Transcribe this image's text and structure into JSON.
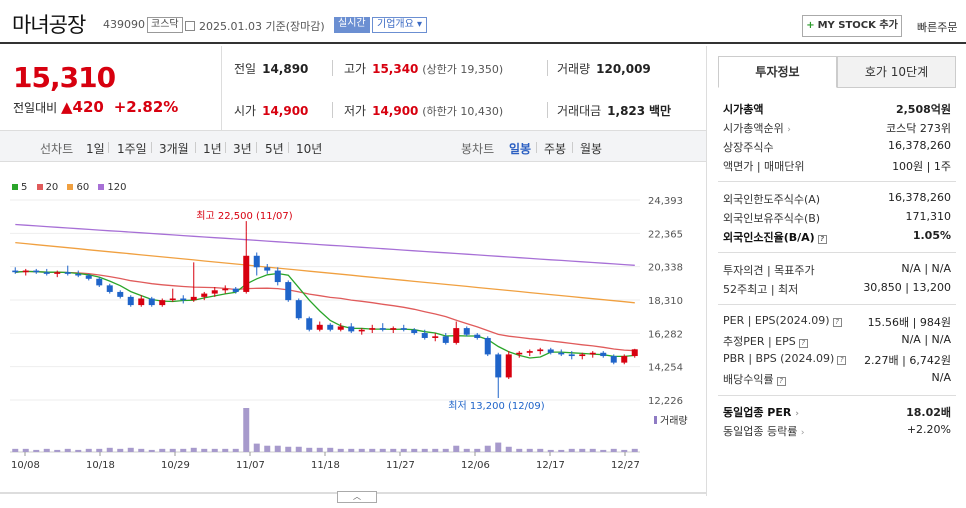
{
  "header": {
    "name": "마녀공장",
    "code": "439090",
    "market_badge": "코스닥",
    "date": "2025.01.03",
    "date_suffix": "기준(장마감)",
    "realtime": "실시간",
    "overview": "기업개요",
    "overview_caret": "▾",
    "mystock_plus": "+",
    "mystock": "MY STOCK 추가",
    "quick_order": "빠른주문"
  },
  "price": {
    "current": "15,310",
    "change_label": "전일대비",
    "change_arrow": "▲",
    "change_value": "420",
    "change_pct": "+2.82%"
  },
  "summary": {
    "prev_label": "전일",
    "prev": "14,890",
    "high_label": "고가",
    "high": "15,340",
    "upper_limit": "(상한가 19,350)",
    "volume_label": "거래량",
    "volume": "120,009",
    "open_label": "시가",
    "open": "14,900",
    "low_label": "저가",
    "low": "14,900",
    "lower_limit": "(하한가 10,430)",
    "amount_label": "거래대금",
    "amount": "1,823",
    "amount_unit": "백만"
  },
  "period_bar": {
    "line_label": "선차트",
    "line_periods": [
      "1일",
      "1주일",
      "3개월",
      "1년",
      "3년",
      "5년",
      "10년"
    ],
    "candle_label": "봉차트",
    "candle_periods": [
      "일봉",
      "주봉",
      "월봉"
    ],
    "active_candle": "일봉"
  },
  "colors": {
    "up": "#d7000f",
    "down": "#1f64c9",
    "accent": "#2b5fc2",
    "ma5": "#2aa52a",
    "ma20": "#e05b5b",
    "ma60": "#f0a040",
    "ma120": "#a770d6"
  },
  "chart_data": {
    "type": "candlestick",
    "legend": [
      {
        "name": "5",
        "color": "#2aa52a"
      },
      {
        "name": "20",
        "color": "#e05b5b"
      },
      {
        "name": "60",
        "color": "#f0a040"
      },
      {
        "name": "120",
        "color": "#a770d6"
      }
    ],
    "y_ticks": [
      "24,393",
      "22,365",
      "20,338",
      "18,310",
      "16,282",
      "14,254",
      "12,226"
    ],
    "ylim": [
      12226,
      24393
    ],
    "x_ticks": [
      "10/08",
      "10/18",
      "10/29",
      "11/07",
      "11/18",
      "11/27",
      "12/06",
      "12/17",
      "12/27"
    ],
    "annotation_high": "최고 22,500 (11/07)",
    "annotation_low": "최저 13,200 (12/09)",
    "volume_label": "거래량",
    "candles": [
      [
        20100,
        20300,
        19900,
        20000
      ],
      [
        20000,
        20200,
        19800,
        20100
      ],
      [
        20100,
        20200,
        19900,
        20000
      ],
      [
        20000,
        20200,
        19800,
        19900
      ],
      [
        19900,
        20100,
        19700,
        20000
      ],
      [
        20000,
        20400,
        19800,
        19900
      ],
      [
        19900,
        20100,
        19700,
        19800
      ],
      [
        19800,
        19900,
        19500,
        19600
      ],
      [
        19600,
        19700,
        19100,
        19200
      ],
      [
        19200,
        19300,
        18700,
        18800
      ],
      [
        18800,
        18900,
        18400,
        18500
      ],
      [
        18500,
        18600,
        17900,
        18000
      ],
      [
        18000,
        18600,
        17900,
        18400
      ],
      [
        18400,
        18500,
        17900,
        18000
      ],
      [
        18000,
        18400,
        17900,
        18300
      ],
      [
        18300,
        19000,
        18200,
        18400
      ],
      [
        18400,
        18600,
        18100,
        18300
      ],
      [
        18300,
        20600,
        18200,
        18500
      ],
      [
        18500,
        18800,
        18300,
        18700
      ],
      [
        18700,
        19100,
        18500,
        18900
      ],
      [
        18900,
        19200,
        18700,
        19000
      ],
      [
        19000,
        19100,
        18700,
        18800
      ],
      [
        18800,
        22500,
        18700,
        21000
      ],
      [
        21000,
        21200,
        19800,
        20300
      ],
      [
        20300,
        20500,
        19900,
        20100
      ],
      [
        20100,
        20300,
        19200,
        19400
      ],
      [
        19400,
        19500,
        18200,
        18300
      ],
      [
        18300,
        18400,
        17100,
        17200
      ],
      [
        17200,
        17300,
        16400,
        16500
      ],
      [
        16500,
        17000,
        16400,
        16800
      ],
      [
        16800,
        16900,
        16400,
        16500
      ],
      [
        16500,
        16900,
        16400,
        16700
      ],
      [
        16700,
        16900,
        16300,
        16400
      ],
      [
        16400,
        16600,
        16200,
        16500
      ],
      [
        16500,
        16800,
        16300,
        16600
      ],
      [
        16600,
        16900,
        16400,
        16500
      ],
      [
        16500,
        16700,
        16300,
        16600
      ],
      [
        16600,
        16800,
        16400,
        16500
      ],
      [
        16500,
        16600,
        16200,
        16300
      ],
      [
        16300,
        16500,
        15900,
        16000
      ],
      [
        16000,
        16300,
        15800,
        16100
      ],
      [
        16100,
        16300,
        15600,
        15700
      ],
      [
        15700,
        17000,
        15600,
        16600
      ],
      [
        16600,
        16700,
        16100,
        16200
      ],
      [
        16200,
        16300,
        15900,
        16000
      ],
      [
        16000,
        16100,
        14900,
        15000
      ],
      [
        15000,
        15100,
        13200,
        13600
      ],
      [
        13600,
        15200,
        13500,
        15000
      ],
      [
        15000,
        15200,
        14800,
        15100
      ],
      [
        15100,
        15300,
        14900,
        15200
      ],
      [
        15200,
        15400,
        15000,
        15300
      ],
      [
        15300,
        15400,
        15000,
        15100
      ],
      [
        15100,
        15300,
        14900,
        15000
      ],
      [
        15000,
        15200,
        14700,
        14900
      ],
      [
        14900,
        15100,
        14700,
        15000
      ],
      [
        15000,
        15200,
        14800,
        15100
      ],
      [
        15100,
        15200,
        14800,
        14900
      ],
      [
        14900,
        15000,
        14400,
        14500
      ],
      [
        14500,
        15000,
        14400,
        14900
      ],
      [
        14900,
        15340,
        14800,
        15310
      ]
    ],
    "volumes": [
      3,
      3,
      2,
      3,
      2,
      3,
      2,
      3,
      3,
      4,
      3,
      4,
      3,
      2,
      3,
      3,
      3,
      4,
      3,
      3,
      3,
      3,
      42,
      8,
      6,
      6,
      5,
      5,
      4,
      4,
      4,
      3,
      3,
      3,
      3,
      3,
      3,
      3,
      3,
      3,
      3,
      3,
      6,
      3,
      3,
      6,
      9,
      5,
      3,
      3,
      3,
      2,
      2,
      3,
      3,
      3,
      2,
      3,
      2,
      3
    ]
  },
  "tabs": {
    "invest": "투자정보",
    "hoga": "호가 10단계"
  },
  "invest": {
    "market_cap_label": "시가총액",
    "market_cap": "2,508억원",
    "market_cap_rank_label": "시가총액순위",
    "market_cap_rank_arrow": "›",
    "market_cap_rank": "코스닥 273위",
    "listed_shares_label": "상장주식수",
    "listed_shares": "16,378,260",
    "face_label": "액면가 | 매매단위",
    "face": "100원 | 1주",
    "foreign_limit_label": "외국인한도주식수(A)",
    "foreign_limit": "16,378,260",
    "foreign_hold_label": "외국인보유주식수(B)",
    "foreign_hold": "171,310",
    "foreign_ratio_label": "외국인소진율(B/A)",
    "foreign_ratio": "1.05%",
    "opinion_label": "투자의견 | 목표주가",
    "opinion": "N/A | N/A",
    "week52_label": "52주최고 | 최저",
    "week52": "30,850 | 13,200",
    "per_label": "PER | EPS(2024.09)",
    "per": "15.56배 | 984원",
    "est_per_label": "추정PER | EPS",
    "est_per": "N/A | N/A",
    "pbr_label": "PBR | BPS (2024.09)",
    "pbr": "2.27배 | 6,742원",
    "dividend_label": "배당수익률",
    "dividend": "N/A",
    "industry_per_label": "동일업종 PER",
    "industry_per_arrow": "›",
    "industry_per": "18.02배",
    "industry_rate_label": "동일업종 등락률",
    "industry_rate_arrow": "›",
    "industry_rate": "+2.20%",
    "help_glyph": "?"
  },
  "toggle_glyph": "︿"
}
